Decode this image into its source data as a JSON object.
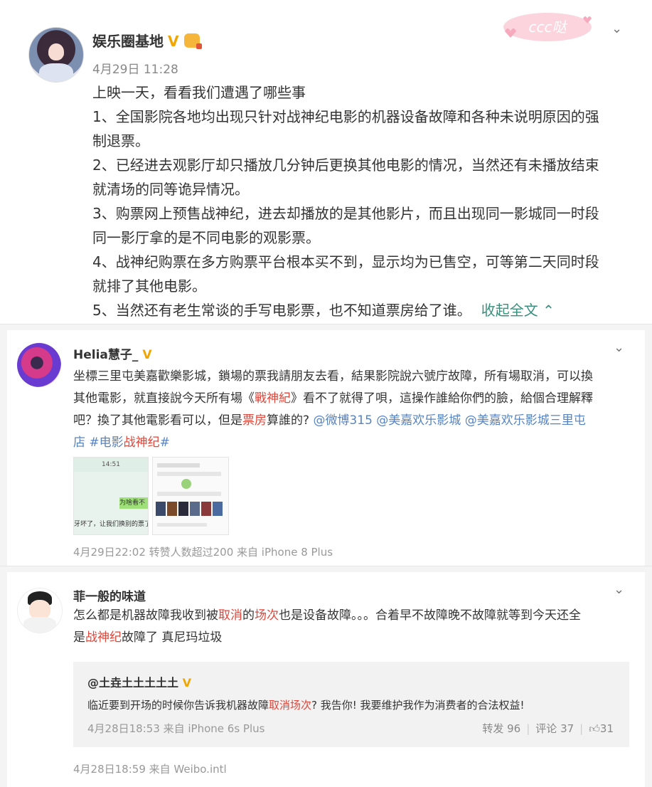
{
  "post": {
    "author": "娱乐圈基地",
    "verified_mark": "V",
    "time": "4月29日 11:28",
    "lines": [
      "上映一天，看看我们遭遇了哪些事",
      "1、全国影院各地均出现只针对战神纪电影的机器设备故障和各种未说明原因的强",
      "制退票。",
      "2、已经进去观影厅却只播放几分钟后更换其他电影的情况，当然还有未播放结束",
      "就清场的同等诡异情况。",
      "3、购票网上预售战神纪，进去却播放的是其他影片，而且出现同一影城同一时段",
      "同一影厅拿的是不同电影的观影票。",
      "4、战神纪购票在多方购票平台根本买不到，显示均为已售空，可等第二天同时段",
      "就排了其他电影。",
      "5、当然还有老生常谈的手写电影票，也不知道票房给了谁。"
    ],
    "collapse_label": "收起全文",
    "collapse_icon": "chevron-up-icon",
    "sticker_text": "ccc哒"
  },
  "comment1": {
    "author": "Helia慧子_",
    "verified_mark": "V",
    "text_lines": [
      {
        "parts": [
          {
            "t": "坐標三里屯美嘉歡樂影城，鎖場的票我請朋友去看，結果影院說六號庁故障，所有場取消，可以換",
            "c": ""
          }
        ]
      },
      {
        "parts": [
          {
            "t": "其他電影，就直接說今天所有場《",
            "c": ""
          },
          {
            "t": "戰神紀",
            "c": "red"
          },
          {
            "t": "》看不了就得了唄，這操作誰給你們的臉，給個合理解釋",
            "c": ""
          }
        ]
      },
      {
        "parts": [
          {
            "t": "吧？換了其他電影看可以，但是",
            "c": ""
          },
          {
            "t": "票房",
            "c": "red"
          },
          {
            "t": "算誰的? ",
            "c": ""
          },
          {
            "t": "@微博315 @美嘉欢乐影城 @美嘉欢乐影城三里屯",
            "c": "link"
          }
        ]
      },
      {
        "parts": [
          {
            "t": "店 #电影",
            "c": "link"
          },
          {
            "t": "战神纪",
            "c": "red"
          },
          {
            "t": "#",
            "c": "link"
          }
        ]
      }
    ],
    "thumb1_time": "14:51",
    "thumb1_bubble": "为啥看不",
    "thumb1_caption": "牙坏了，让我们换别的票了",
    "meta": "4月29日22:02 转赞人数超过200 来自 iPhone 8 Plus"
  },
  "comment2": {
    "author": "菲一般的味道",
    "text_lines": [
      {
        "parts": [
          {
            "t": "怎么都是机器故障我收到被",
            "c": ""
          },
          {
            "t": "取消",
            "c": "red"
          },
          {
            "t": "的",
            "c": ""
          },
          {
            "t": "场次",
            "c": "red"
          },
          {
            "t": "也是设备故障。。。合着早不故障晚不故障就等到今天还全",
            "c": ""
          }
        ]
      },
      {
        "parts": [
          {
            "t": "是",
            "c": ""
          },
          {
            "t": "战神纪",
            "c": "red"
          },
          {
            "t": "故障了 真尼玛垃圾",
            "c": ""
          }
        ]
      }
    ],
    "quote": {
      "author": "@土垚土土土土土",
      "verified_mark": "V",
      "text_parts": [
        {
          "t": "临近要到开场的时候你告诉我机器故障",
          "c": ""
        },
        {
          "t": "取消场次",
          "c": "red"
        },
        {
          "t": "? 我告你! 我要维护我作为消费者的合法权益!",
          "c": ""
        }
      ],
      "time": "4月28日18:53 来自 iPhone 6s Plus",
      "repost": "转发 96",
      "comment": "评论 37",
      "like": "31"
    },
    "meta": "4月28日18:59 来自 Weibo.intl"
  },
  "colors": {
    "accent_green": "#3a8f7c",
    "highlight_red": "#e0463a",
    "link_blue": "#5783c2",
    "verified_gold": "#f0a500"
  }
}
